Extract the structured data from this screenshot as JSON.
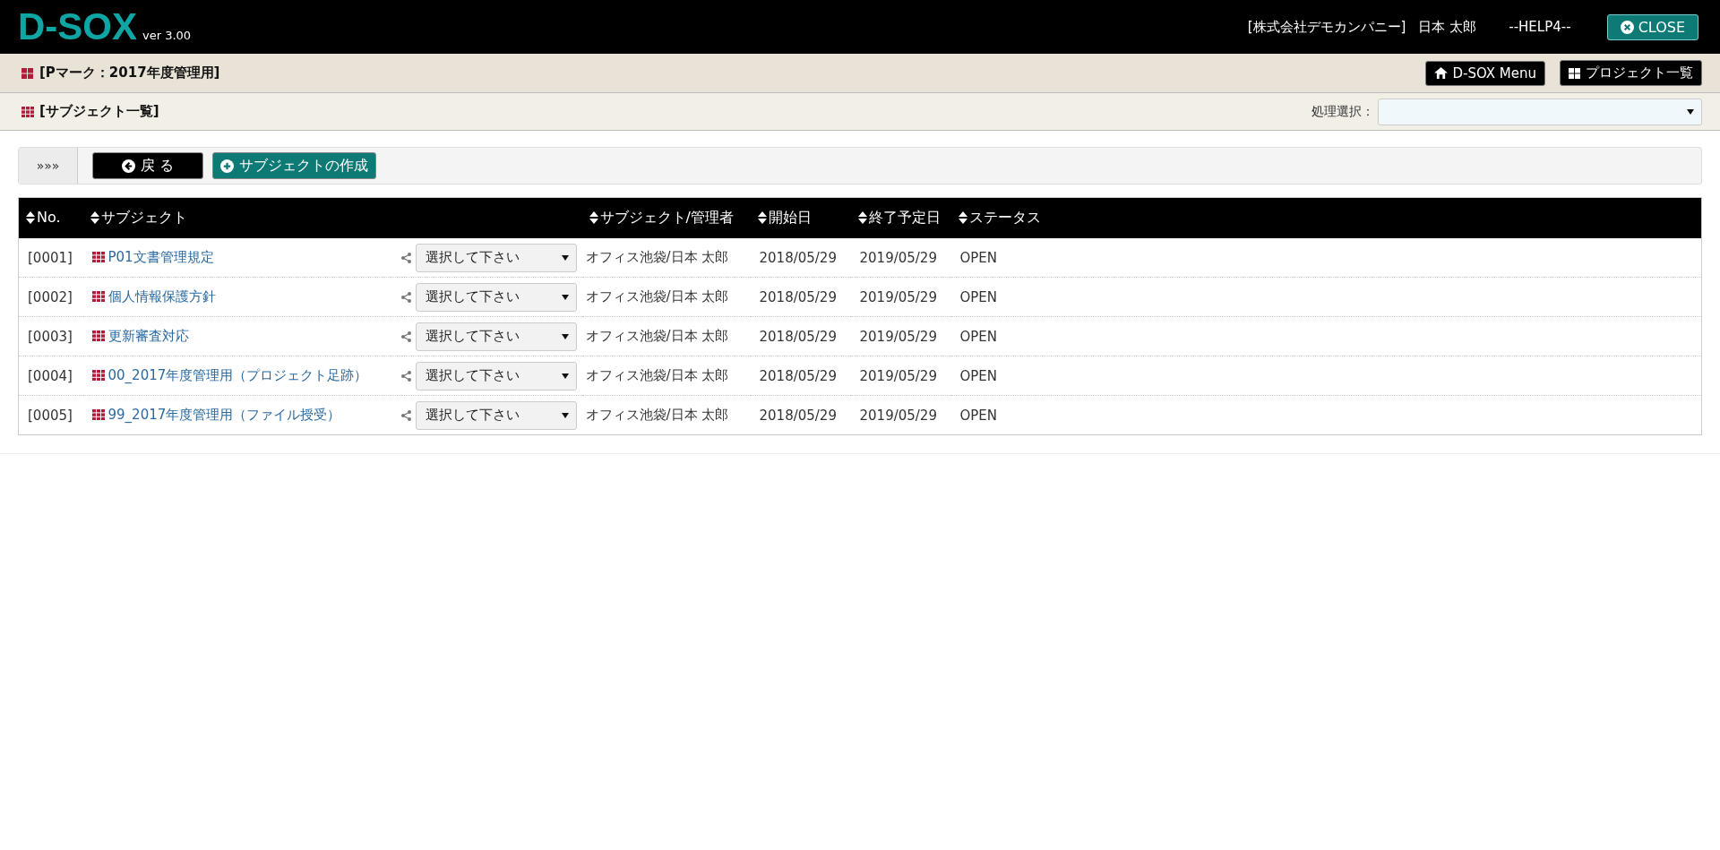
{
  "header": {
    "logo": "D-SOX",
    "version": "ver 3.00",
    "company": "[株式会社デモカンパニー]",
    "user": "日本 太郎",
    "help": "--HELP4--",
    "close_button": "CLOSE"
  },
  "project_bar": {
    "title": "[Pマーク：2017年度管理用]",
    "buttons": [
      {
        "label": "D-SOX Menu",
        "kind": "home"
      },
      {
        "label": "プロジェクト一覧",
        "kind": "list"
      }
    ]
  },
  "page_bar": {
    "title": "[サブジェクト一覧]",
    "action_label": "処理選択："
  },
  "toolbar": {
    "toggle": "»»»",
    "buttons": [
      {
        "label": "戻 る",
        "kind": "back"
      },
      {
        "label": "サブジェクトの作成",
        "kind": "create"
      }
    ]
  },
  "table": {
    "columns": [
      "No.",
      "サブジェクト",
      "サブジェクト/管理者",
      "開始日",
      "終了予定日",
      "ステータス"
    ],
    "rows": [
      {
        "no": "[0001]",
        "subject": "P01文書管理規定",
        "select": "選択して下さい",
        "manager": "オフィス池袋/日本 太郎",
        "start": "2018/05/29",
        "end": "2019/05/29",
        "status": "OPEN"
      },
      {
        "no": "[0002]",
        "subject": "個人情報保護方針",
        "select": "選択して下さい",
        "manager": "オフィス池袋/日本 太郎",
        "start": "2018/05/29",
        "end": "2019/05/29",
        "status": "OPEN"
      },
      {
        "no": "[0003]",
        "subject": "更新審査対応",
        "select": "選択して下さい",
        "manager": "オフィス池袋/日本 太郎",
        "start": "2018/05/29",
        "end": "2019/05/29",
        "status": "OPEN"
      },
      {
        "no": "[0004]",
        "subject": "00_2017年度管理用（プロジェクト足跡）",
        "select": "選択して下さい",
        "manager": "オフィス池袋/日本 太郎",
        "start": "2018/05/29",
        "end": "2019/05/29",
        "status": "OPEN"
      },
      {
        "no": "[0005]",
        "subject": "99_2017年度管理用（ファイル授受）",
        "select": "選択して下さい",
        "manager": "オフィス池袋/日本 太郎",
        "start": "2018/05/29",
        "end": "2019/05/29",
        "status": "OPEN"
      }
    ]
  }
}
